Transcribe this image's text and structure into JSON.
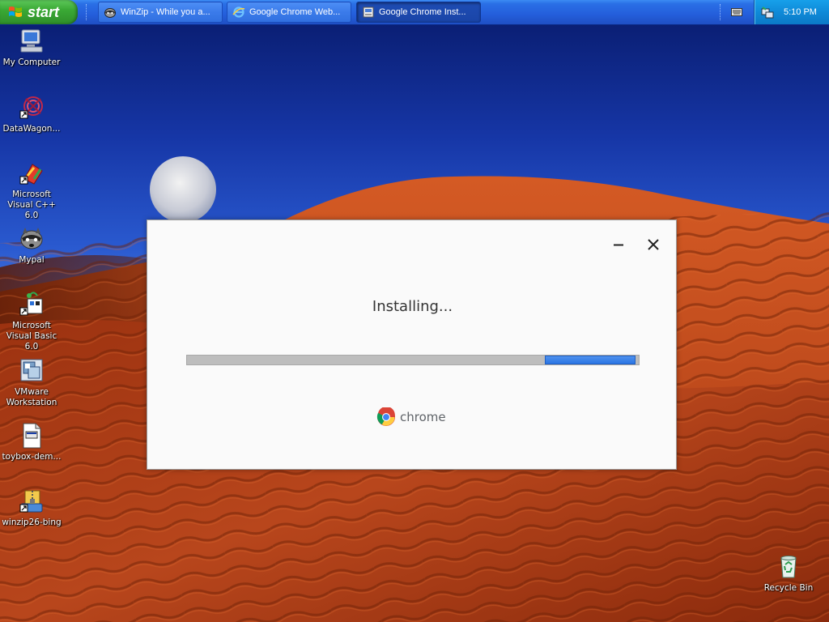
{
  "taskbar": {
    "start_label": "start",
    "tasks": [
      {
        "label": "WinZip - While you a...",
        "icon": "winzip-raccoon-icon"
      },
      {
        "label": "Google Chrome Web...",
        "icon": "internet-explorer-icon"
      },
      {
        "label": "Google Chrome Inst...",
        "icon": "installer-icon",
        "active": true
      }
    ],
    "clock": "5:10 PM"
  },
  "desktop_icons": [
    {
      "label": "My Computer",
      "icon": "computer-icon"
    },
    {
      "label": "DataWagon...",
      "icon": "datawagon-icon"
    },
    {
      "label": "Microsoft Visual C++ 6.0",
      "icon": "visual-cpp-icon"
    },
    {
      "label": "Mypal",
      "icon": "mypal-raccoon-icon"
    },
    {
      "label": "Microsoft Visual Basic 6.0",
      "icon": "visual-basic-icon"
    },
    {
      "label": "VMware Workstation",
      "icon": "vmware-icon"
    },
    {
      "label": "toybox-dem...",
      "icon": "exe-file-icon"
    },
    {
      "label": "winzip26-bing",
      "icon": "winzip-installer-icon"
    },
    {
      "label": "Recycle Bin",
      "icon": "recycle-bin-icon"
    }
  ],
  "installer": {
    "status": "Installing...",
    "progress": 0.21,
    "brand": "chrome"
  },
  "colors": {
    "taskbar_blue": "#245edb",
    "start_green": "#3aa935",
    "tray_blue": "#0f8ad8",
    "progress_blue": "#2a74e3",
    "progress_track": "#bdbdbd",
    "dune_red": "#b8401a"
  }
}
